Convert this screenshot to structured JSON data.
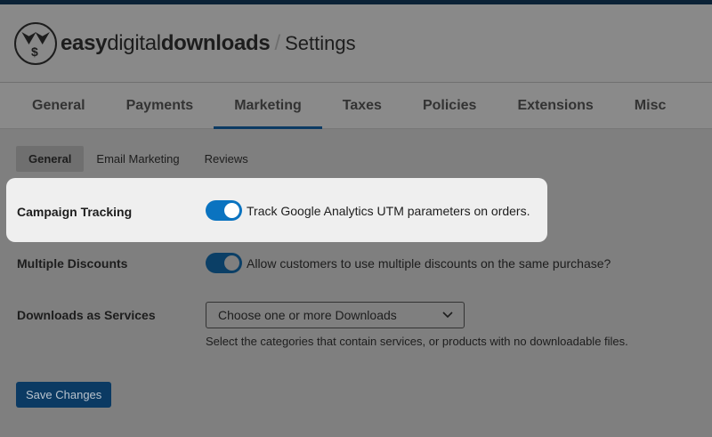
{
  "header": {
    "brand_easy": "easy",
    "brand_digital": "digital",
    "brand_downloads": "downloads",
    "separator": "/",
    "title": "Settings"
  },
  "tabs": [
    "General",
    "Payments",
    "Marketing",
    "Taxes",
    "Policies",
    "Extensions",
    "Misc"
  ],
  "subtabs": [
    "General",
    "Email Marketing",
    "Reviews"
  ],
  "settings": {
    "campaign": {
      "label": "Campaign Tracking",
      "description": "Track Google Analytics UTM parameters on orders.",
      "enabled": true
    },
    "discounts": {
      "label": "Multiple Discounts",
      "description": "Allow customers to use multiple discounts on the same purchase?",
      "enabled": true
    },
    "services": {
      "label": "Downloads as Services",
      "placeholder": "Choose one or more Downloads",
      "help": "Select the categories that contain services, or products with no downloadable files."
    }
  },
  "save_label": "Save Changes",
  "colors": {
    "accent": "#0a73c0",
    "topbar": "#0b2236"
  }
}
